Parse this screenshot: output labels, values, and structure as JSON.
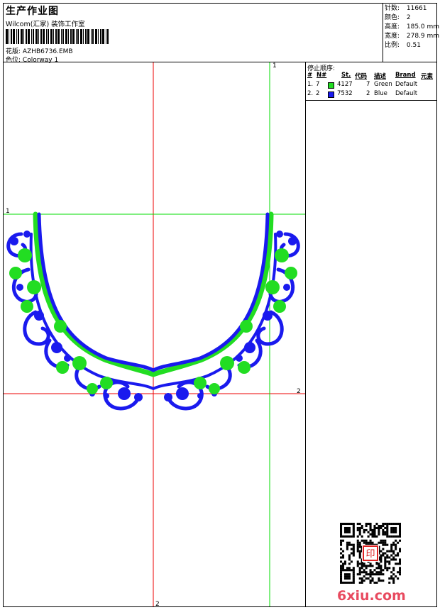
{
  "header": {
    "title": "生产作业图",
    "studio": "Wilcom(汇家) 装饰工作室",
    "design_label": "花版:",
    "design_value": "AZHB6736.EMB",
    "colorway_label": "色位:",
    "colorway_value": "Colorway 1"
  },
  "stats": {
    "stitches_label": "针数:",
    "stitches_value": "11661",
    "colors_label": "颜色:",
    "colors_value": "2",
    "height_label": "高度:",
    "height_value": "185.0 mm",
    "width_label": "宽度:",
    "width_value": "278.9 mm",
    "scale_label": "比例:",
    "scale_value": "0.51"
  },
  "stop_sequence": {
    "title": "停止顺序:",
    "headers": [
      "#",
      "N#",
      "St.",
      "代码",
      "描述",
      "Brand",
      "元素"
    ],
    "rows": [
      {
        "index": "1.",
        "needle": "7",
        "code": "4127",
        "st": "7",
        "desc": "Green",
        "brand": "Default",
        "color": "#22dd22"
      },
      {
        "index": "2.",
        "needle": "2",
        "code": "7532",
        "st": "2",
        "desc": "Blue",
        "brand": "Default",
        "color": "#1a1aee"
      }
    ]
  },
  "design_view": {
    "guide_labels": {
      "green_top": "1",
      "green_left": "1",
      "red_right": "2",
      "red_bottom": "2"
    },
    "colors": {
      "green": "#22dd22",
      "blue": "#1a1aee",
      "red_guide": "#ee0000",
      "green_guide": "#00dd00"
    }
  },
  "watermark": {
    "text": "6xiu.com",
    "seal": "印"
  }
}
